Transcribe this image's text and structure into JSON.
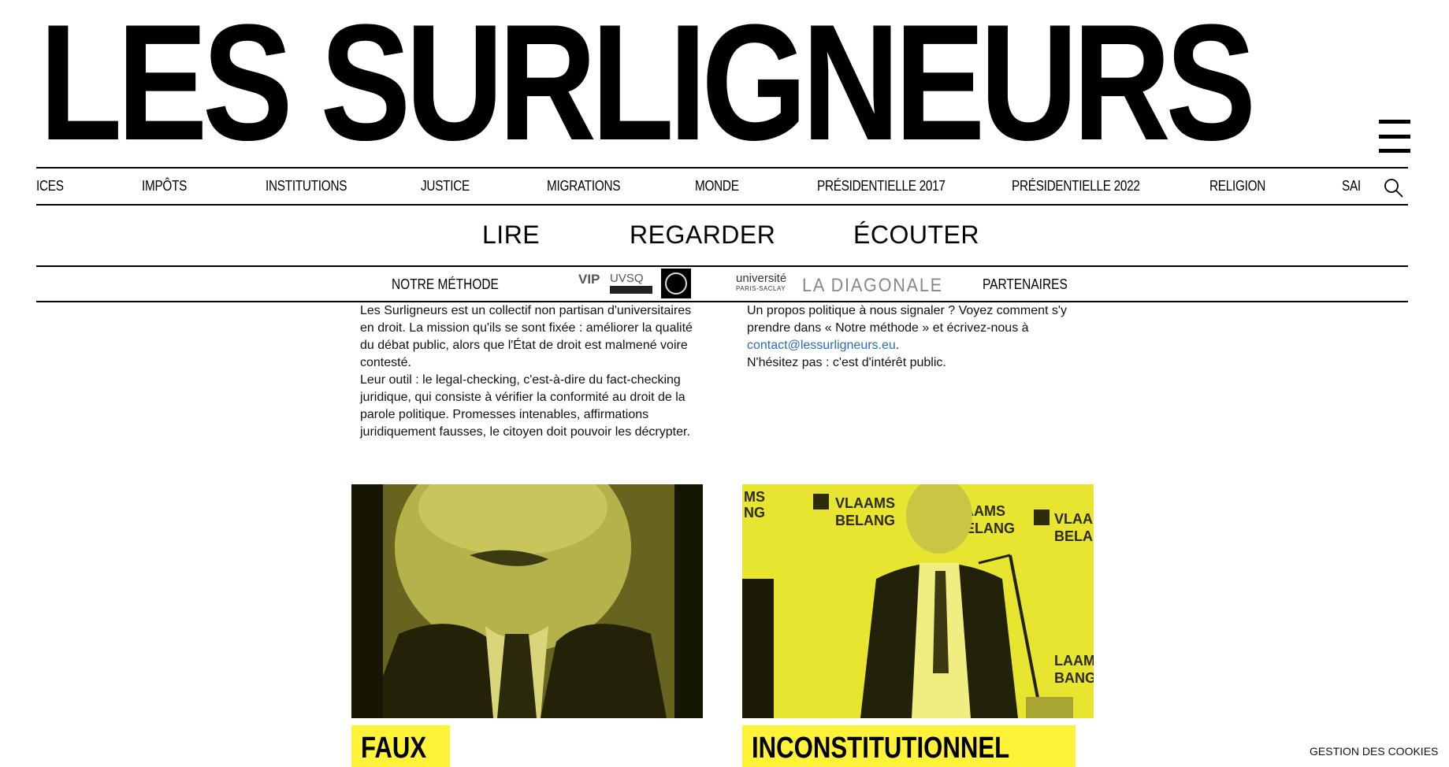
{
  "site": {
    "title": "LES SURLIGNEURS"
  },
  "categories": [
    "ICES",
    "IMPÔTS",
    "INSTITUTIONS",
    "JUSTICE",
    "MIGRATIONS",
    "MONDE",
    "PRÉSIDENTIELLE 2017",
    "PRÉSIDENTIELLE 2022",
    "RELIGION",
    "SAI"
  ],
  "media_tabs": [
    "LIRE",
    "REGARDER",
    "ÉCOUTER"
  ],
  "partners_bar": {
    "method_label": "NOTRE MÉTHODE",
    "partners_label": "PARTENAIRES",
    "logo_vip": {
      "vip": "VIP",
      "uvsq": "UVSQ"
    },
    "logo_ups": {
      "line1": "université",
      "line2": "PARIS-SACLAY"
    },
    "logo_diagonale": "LA DIAGONALE"
  },
  "intro_left": {
    "para1": "Les Surligneurs est un collectif non partisan d'universitaires en droit. La mission qu'ils se sont fixée : améliorer la qualité du débat public, alors que l'État de droit est malmené voire contesté.",
    "para2": "Leur outil : le legal-checking, c'est-à-dire du fact-checking juridique, qui consiste à vérifier la conformité au droit de la parole politique. Promesses intenables, affirmations juridiquement fausses, le citoyen doit pouvoir les décrypter."
  },
  "intro_right": {
    "text1": "Un propos politique à nous signaler ? Voyez comment s'y prendre dans « Notre méthode » et écrivez-nous à",
    "email": "contact@lessurligneurs.eu",
    "text1_end": ".",
    "text2": "N'hésitez pas : c'est d'intérêt public."
  },
  "cards": [
    {
      "verdict": "FAUX"
    },
    {
      "verdict": "INCONSTITUTIONNEL",
      "sign_text": "VLAAMS BELANG"
    }
  ],
  "cookies_label": "GESTION DES COOKIES",
  "colors": {
    "highlight": "#fff33a",
    "link": "#2a6db6",
    "text": "#000000"
  }
}
